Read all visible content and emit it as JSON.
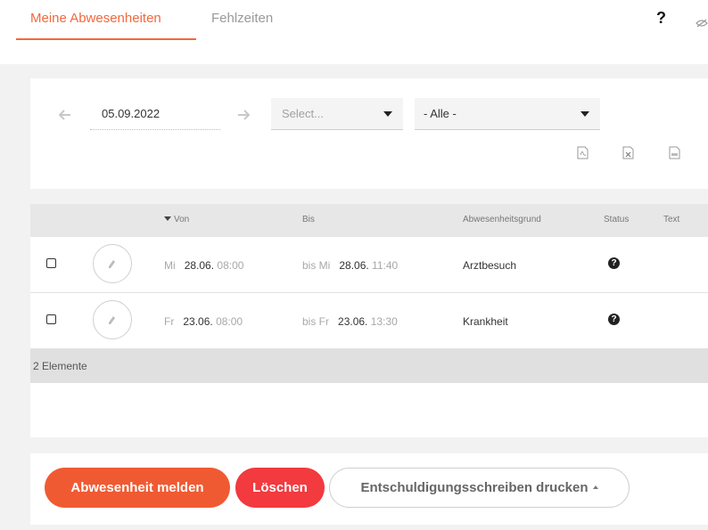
{
  "tabs": [
    {
      "label": "Meine Abwesenheiten",
      "active": true
    },
    {
      "label": "Fehlzeiten",
      "active": false
    }
  ],
  "header": {
    "help_label": "?",
    "icons": [
      "help-icon",
      "eye-icon"
    ]
  },
  "filters": {
    "date_value": "05.09.2022",
    "select_1": {
      "value": "",
      "placeholder": "Select..."
    },
    "select_2": {
      "value": "- Alle -"
    },
    "export_icons": [
      "pdf-icon",
      "excel-icon",
      "csv-icon"
    ]
  },
  "table": {
    "headers": {
      "von": "Von",
      "bis": "Bis",
      "grund": "Abwesenheitsgrund",
      "status": "Status",
      "text": "Text"
    },
    "rows": [
      {
        "from_day": "Mi",
        "from_date": "28.06.",
        "from_time": "08:00",
        "to_prefix": "bis Mi",
        "to_date": "28.06.",
        "to_time": "11:40",
        "reason": "Arztbesuch",
        "status_icon": "question-circle-icon"
      },
      {
        "from_day": "Fr",
        "from_date": "23.06.",
        "from_time": "08:00",
        "to_prefix": "bis Fr",
        "to_date": "23.06.",
        "to_time": "13:30",
        "reason": "Krankheit",
        "status_icon": "question-circle-icon"
      }
    ],
    "count_label": "2 Elemente"
  },
  "actions": {
    "report_label": "Abwesenheit melden",
    "delete_label": "Löschen",
    "print_label": "Entschuldigungsschreiben drucken"
  },
  "colors": {
    "accent": "#f2683d",
    "primary_button": "#f05a32",
    "danger_button": "#f23a3f",
    "header_bg": "#e7e7e7",
    "footer_bg": "#e0e0e0"
  }
}
